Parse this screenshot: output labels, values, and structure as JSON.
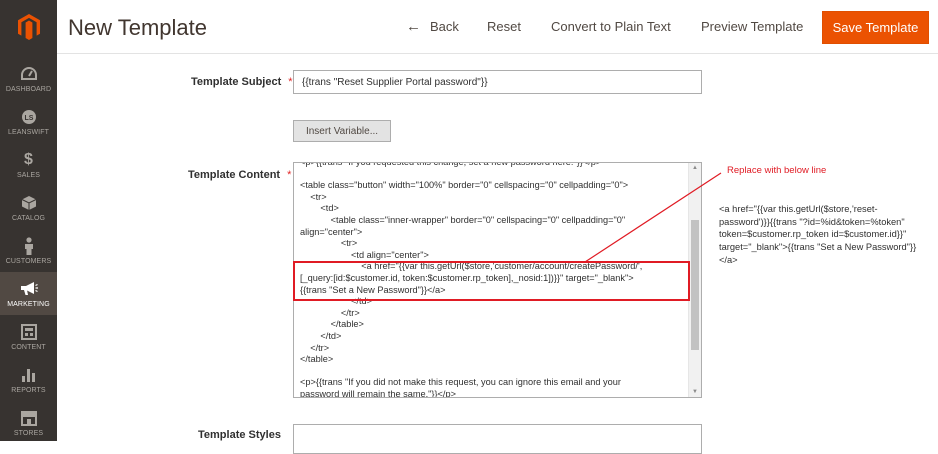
{
  "header": {
    "title": "New Template",
    "back_label": "Back",
    "reset_label": "Reset",
    "plain_text_label": "Convert to Plain Text",
    "preview_label": "Preview Template",
    "save_label": "Save Template"
  },
  "sidebar": {
    "items": [
      {
        "label": "DASHBOARD",
        "icon": "dashboard-icon"
      },
      {
        "label": "LEANSWIFT",
        "icon": "leanswift-icon"
      },
      {
        "label": "SALES",
        "icon": "dollar-icon"
      },
      {
        "label": "CATALOG",
        "icon": "box-icon"
      },
      {
        "label": "CUSTOMERS",
        "icon": "person-icon"
      },
      {
        "label": "MARKETING",
        "icon": "megaphone-icon"
      },
      {
        "label": "CONTENT",
        "icon": "layout-icon"
      },
      {
        "label": "REPORTS",
        "icon": "bar-chart-icon"
      },
      {
        "label": "STORES",
        "icon": "store-icon"
      }
    ]
  },
  "form": {
    "subject_label": "Template Subject",
    "subject_value": "{{trans \"Reset Supplier Portal password\"}}",
    "insert_variable_label": "Insert Variable...",
    "content_label": "Template Content",
    "styles_label": "Template Styles",
    "required_mark": "*",
    "content_lines": [
      "<p>{{trans \"If you requested this change, set a new password here:\"}}</p>",
      "",
      "<table class=\"button\" width=\"100%\" border=\"0\" cellspacing=\"0\" cellpadding=\"0\">",
      "    <tr>",
      "        <td>",
      "            <table class=\"inner-wrapper\" border=\"0\" cellspacing=\"0\" cellpadding=\"0\"",
      "align=\"center\">",
      "                <tr>",
      "                    <td align=\"center\">",
      "                        <a href=\"{{var this.getUrl($store,'customer/account/createPassword/',",
      "[_query:[id:$customer.id, token:$customer.rp_token],_nosid:1])}}\" target=\"_blank\">",
      "{{trans \"Set a New Password\"}}</a>",
      "                    </td>",
      "                </tr>",
      "            </table>",
      "        </td>",
      "    </tr>",
      "</table>",
      "",
      "<p>{{trans \"If you did not make this request, you can ignore this email and your",
      "password will remain the same.\"}}</p>"
    ]
  },
  "annotation": {
    "label": "Replace with below line",
    "replacement_text": "<a href=\"{{var this.getUrl($store,'reset-password')}}{{trans \"?id=%id&token=%token\" token=$customer.rp_token id=$customer.id}}\" target=\"_blank\">{{trans \"Set a New Password\"}}</a>",
    "color": "#e01b24"
  },
  "colors": {
    "sidebar_bg": "#373330",
    "sidebar_active": "#514943",
    "accent": "#eb5202"
  }
}
